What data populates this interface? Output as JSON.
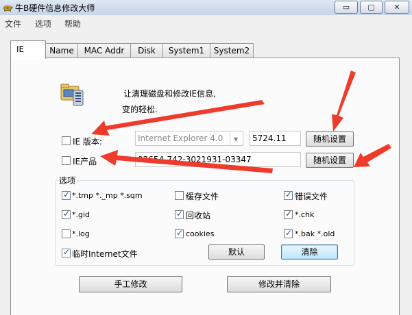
{
  "window": {
    "title": "牛B硬件信息修改大师",
    "buttons": {
      "minimize": "▭",
      "maximize": "▢",
      "close": "✕"
    }
  },
  "menu": [
    "文件",
    "选项",
    "帮助"
  ],
  "tabs": [
    "IE",
    "Name",
    "MAC Addr",
    "Disk",
    "System1",
    "System2"
  ],
  "ie_tab": {
    "intro_line1": "让清理磁盘和修改IE信息,",
    "intro_line2": "变的轻松.",
    "version": {
      "label": "IE 版本:",
      "checked": false,
      "combo_value": "Internet Explorer 4.0",
      "build": "5724.11",
      "random_button": "随机设置"
    },
    "product": {
      "label": "IE产品",
      "checked": false,
      "value": "92654-742-3021931-03347",
      "random_button": "随机设置"
    },
    "options": {
      "title": "选项",
      "items": [
        {
          "label": "*.tmp  *._mp  *.sqm",
          "checked": true
        },
        {
          "label": "缓存文件",
          "checked": false
        },
        {
          "label": "错误文件",
          "checked": true
        },
        {
          "label": "*.gid",
          "checked": true
        },
        {
          "label": "回收站",
          "checked": true
        },
        {
          "label": "*.chk",
          "checked": true
        },
        {
          "label": "*.log",
          "checked": false
        },
        {
          "label": "cookies",
          "checked": true
        },
        {
          "label": "*.bak  *.old",
          "checked": true
        },
        {
          "label": "临时Internet文件",
          "checked": true
        }
      ],
      "default_button": "默认",
      "clear_button": "清除"
    },
    "manual_button": "手工修改",
    "modify_clear_button": "修改并清除"
  },
  "colors": {
    "annotation_arrow": "#ee3b2c",
    "title_gradient_top": "#dfe8f3",
    "title_gradient_bottom": "#c6d5e8"
  }
}
